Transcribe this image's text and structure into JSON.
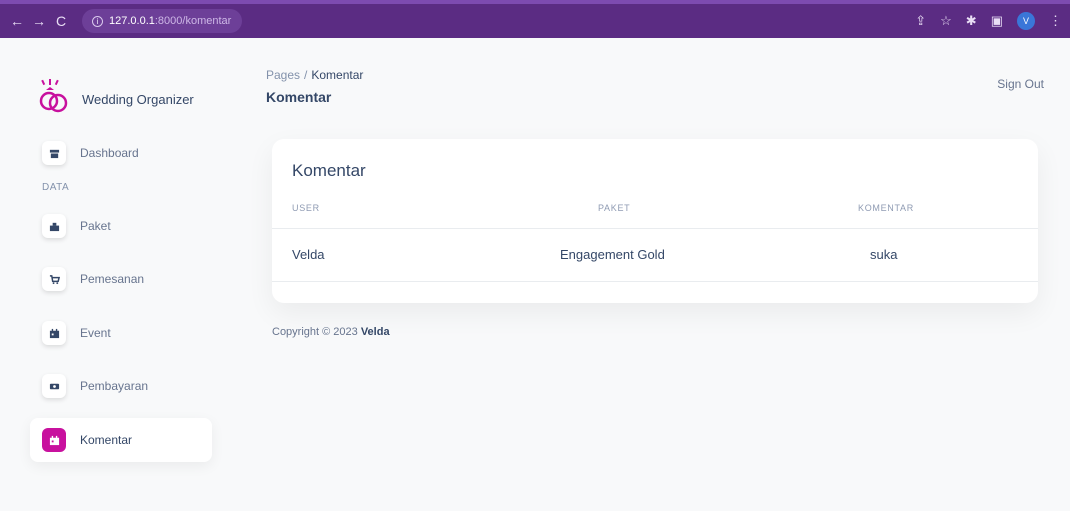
{
  "browser": {
    "url_host": "127.0.0.1",
    "url_path": ":8000/komentar",
    "profile_initial": "V"
  },
  "sidebar": {
    "brand_name": "Wedding Organizer",
    "section_label": "DATA",
    "items": [
      {
        "label": "Dashboard",
        "icon": "shop-icon"
      },
      {
        "label": "Paket",
        "icon": "building-icon"
      },
      {
        "label": "Pemesanan",
        "icon": "cart-icon"
      },
      {
        "label": "Event",
        "icon": "calendar-icon"
      },
      {
        "label": "Pembayaran",
        "icon": "money-icon"
      },
      {
        "label": "Komentar",
        "icon": "calendar-icon",
        "active": true
      }
    ]
  },
  "header": {
    "breadcrumb_root": "Pages",
    "breadcrumb_sep": "/",
    "breadcrumb_current": "Komentar",
    "title": "Komentar",
    "sign_out": "Sign Out"
  },
  "card": {
    "title": "Komentar",
    "columns": [
      "USER",
      "PAKET",
      "KOMENTAR"
    ],
    "rows": [
      {
        "user": "Velda",
        "paket": "Engagement Gold",
        "komentar": "suka"
      }
    ]
  },
  "footer": {
    "prefix": "Copyright © 2023",
    "author": "Velda"
  },
  "colors": {
    "accent": "#c8119e",
    "browser_bar": "#5b2c83"
  }
}
